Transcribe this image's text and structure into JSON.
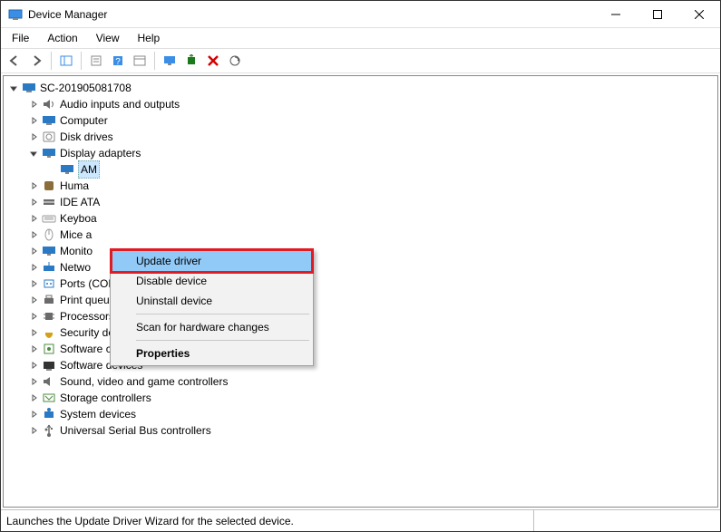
{
  "window": {
    "title": "Device Manager"
  },
  "menu": {
    "items": [
      "File",
      "Action",
      "View",
      "Help"
    ]
  },
  "toolbar_icons": [
    "back-icon",
    "forward-icon",
    "show-hidden-icon",
    "properties-icon",
    "help-icon",
    "options-icon",
    "monitor-icon",
    "update-driver-icon",
    "uninstall-icon",
    "scan-icon"
  ],
  "tree": {
    "root": "SC-201905081708",
    "items": [
      {
        "label": "Audio inputs and outputs",
        "icon": "audio"
      },
      {
        "label": "Computer",
        "icon": "computer"
      },
      {
        "label": "Disk drives",
        "icon": "disk"
      },
      {
        "label": "Display adapters",
        "icon": "display",
        "expanded": true,
        "children": [
          {
            "label": "AM",
            "icon": "display",
            "selected": true
          }
        ]
      },
      {
        "label": "Huma",
        "icon": "hid"
      },
      {
        "label": "IDE ATA",
        "icon": "ide"
      },
      {
        "label": "Keyboa",
        "icon": "keyboard"
      },
      {
        "label": "Mice a",
        "icon": "mouse"
      },
      {
        "label": "Monito",
        "icon": "monitor"
      },
      {
        "label": "Netwo",
        "icon": "network"
      },
      {
        "label": "Ports (COM & LPT)",
        "icon": "port"
      },
      {
        "label": "Print queues",
        "icon": "printer"
      },
      {
        "label": "Processors",
        "icon": "cpu"
      },
      {
        "label": "Security devices",
        "icon": "security"
      },
      {
        "label": "Software components",
        "icon": "swcomp"
      },
      {
        "label": "Software devices",
        "icon": "swdev"
      },
      {
        "label": "Sound, video and game controllers",
        "icon": "sound"
      },
      {
        "label": "Storage controllers",
        "icon": "storage"
      },
      {
        "label": "System devices",
        "icon": "system"
      },
      {
        "label": "Universal Serial Bus controllers",
        "icon": "usb"
      }
    ]
  },
  "context_menu": {
    "items": [
      {
        "label": "Update driver",
        "highlight": true
      },
      {
        "label": "Disable device"
      },
      {
        "label": "Uninstall device"
      },
      {
        "sep": true
      },
      {
        "label": "Scan for hardware changes"
      },
      {
        "sep": true
      },
      {
        "label": "Properties",
        "bold": true
      }
    ]
  },
  "status": {
    "text": "Launches the Update Driver Wizard for the selected device."
  },
  "icon_colors": {
    "audio": "#6b6b6b",
    "computer": "#2a79c4",
    "disk": "#888",
    "display": "#2a79c4",
    "hid": "#8a6d3b",
    "ide": "#6b6b6b",
    "keyboard": "#9a9a9a",
    "mouse": "#9a9a9a",
    "monitor": "#2a79c4",
    "network": "#2a79c4",
    "port": "#2a79c4",
    "printer": "#6b6b6b",
    "cpu": "#6b6b6b",
    "security": "#d4a017",
    "swcomp": "#4b8b3b",
    "swdev": "#333",
    "sound": "#6b6b6b",
    "storage": "#4b8b3b",
    "system": "#2a79c4",
    "usb": "#6b6b6b"
  }
}
